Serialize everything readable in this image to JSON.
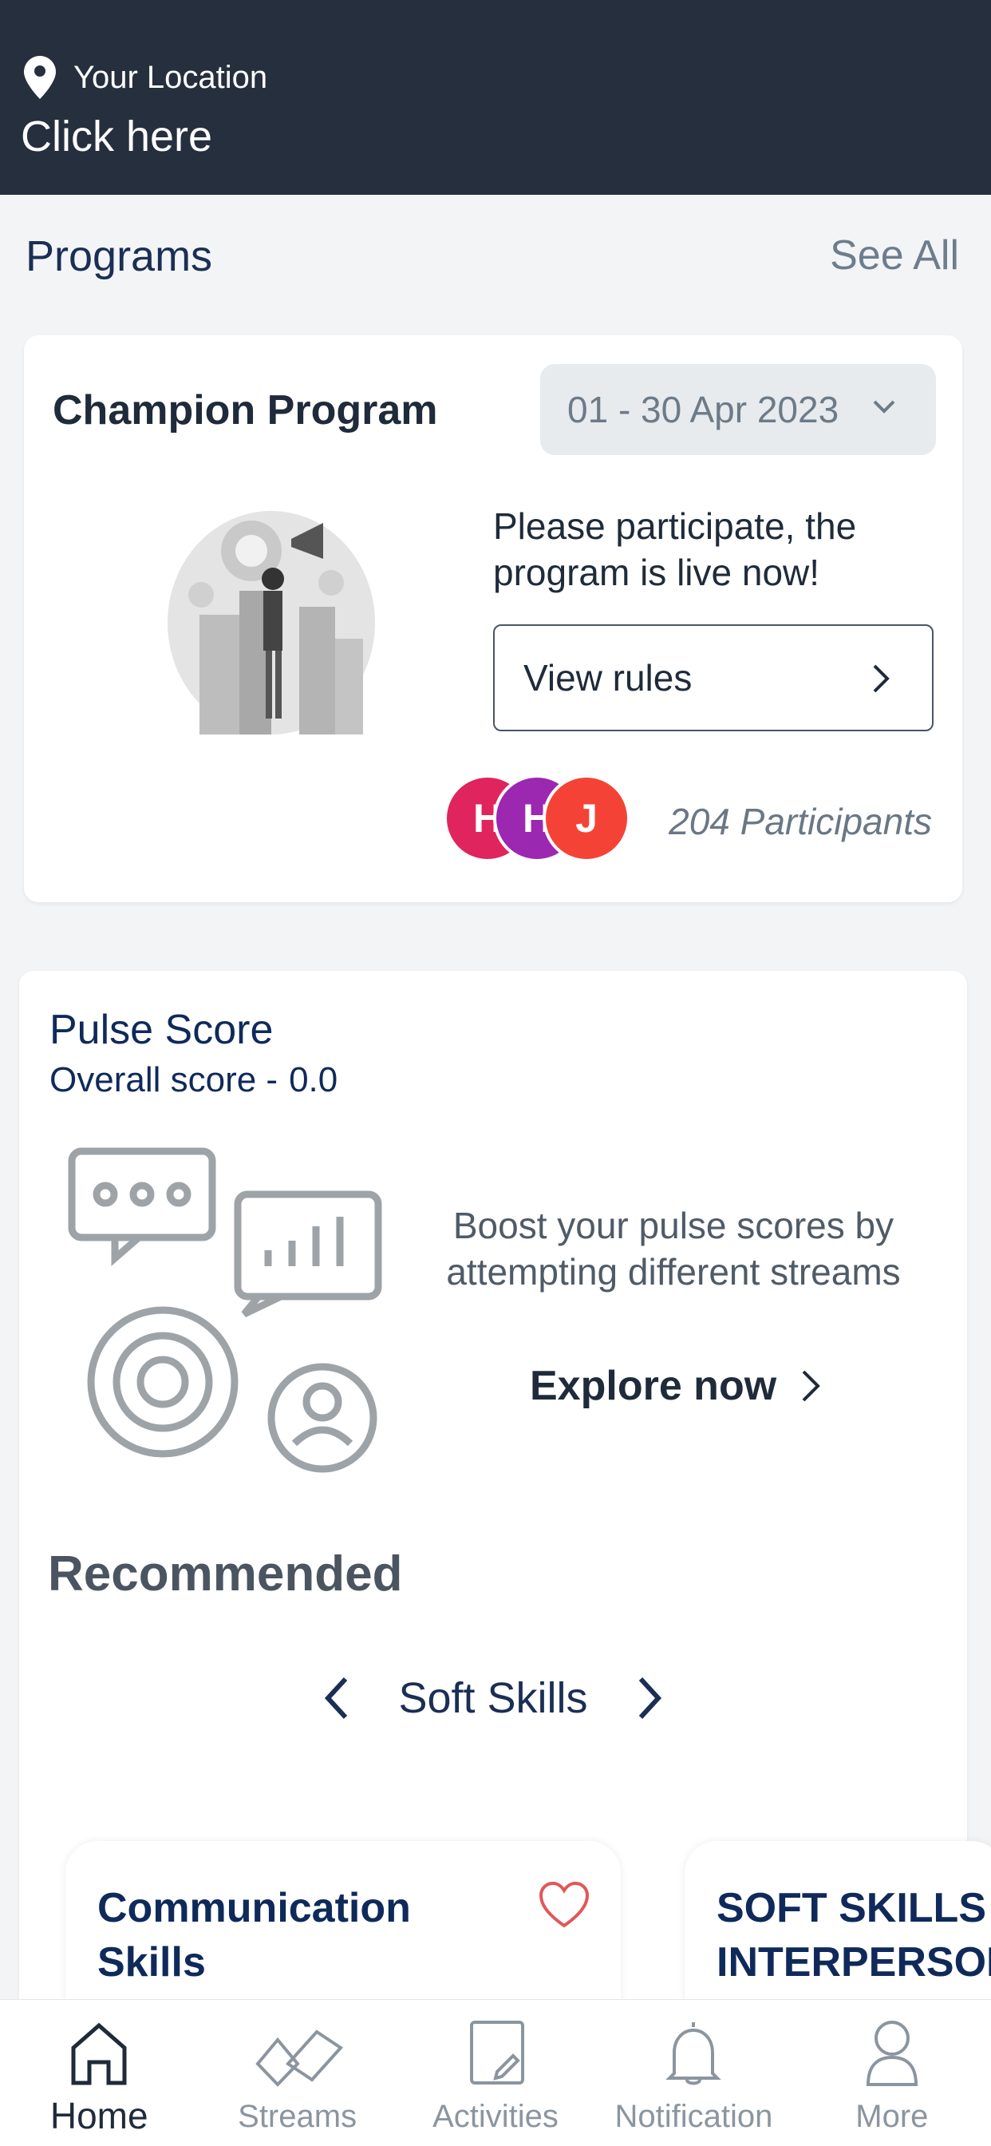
{
  "header": {
    "location_label": "Your Location",
    "click_here": "Click here"
  },
  "programs": {
    "title": "Programs",
    "see_all": "See All",
    "card": {
      "title": "Champion Program",
      "date_range": "01 - 30 Apr 2023",
      "message": "Please participate, the program is live now!",
      "view_rules": "View rules",
      "avatars": [
        {
          "letter": "H",
          "color": "#e0245e"
        },
        {
          "letter": "H",
          "color": "#9c27b0"
        },
        {
          "letter": "J",
          "color": "#f44336"
        }
      ],
      "participants": "204 Participants"
    }
  },
  "pulse": {
    "title": "Pulse Score",
    "overall_label": "Overall score -",
    "overall_value": "0.0",
    "boost_text": "Boost your pulse scores by attempting different streams",
    "explore": "Explore now",
    "recommended": "Recommended",
    "category": "Soft Skills",
    "cards": [
      {
        "title": "Communication Skills"
      },
      {
        "title": "SOFT SKILLS INTERPERSONAL"
      }
    ]
  },
  "nav": {
    "items": [
      {
        "label": "Home",
        "icon": "home-icon"
      },
      {
        "label": "Streams",
        "icon": "streams-icon"
      },
      {
        "label": "Activities",
        "icon": "activities-icon"
      },
      {
        "label": "Notification",
        "icon": "bell-icon"
      },
      {
        "label": "More",
        "icon": "user-icon"
      }
    ]
  },
  "colors": {
    "header_bg": "#262f3e",
    "primary_text": "#0f2a5a",
    "heart": "#e25757"
  }
}
